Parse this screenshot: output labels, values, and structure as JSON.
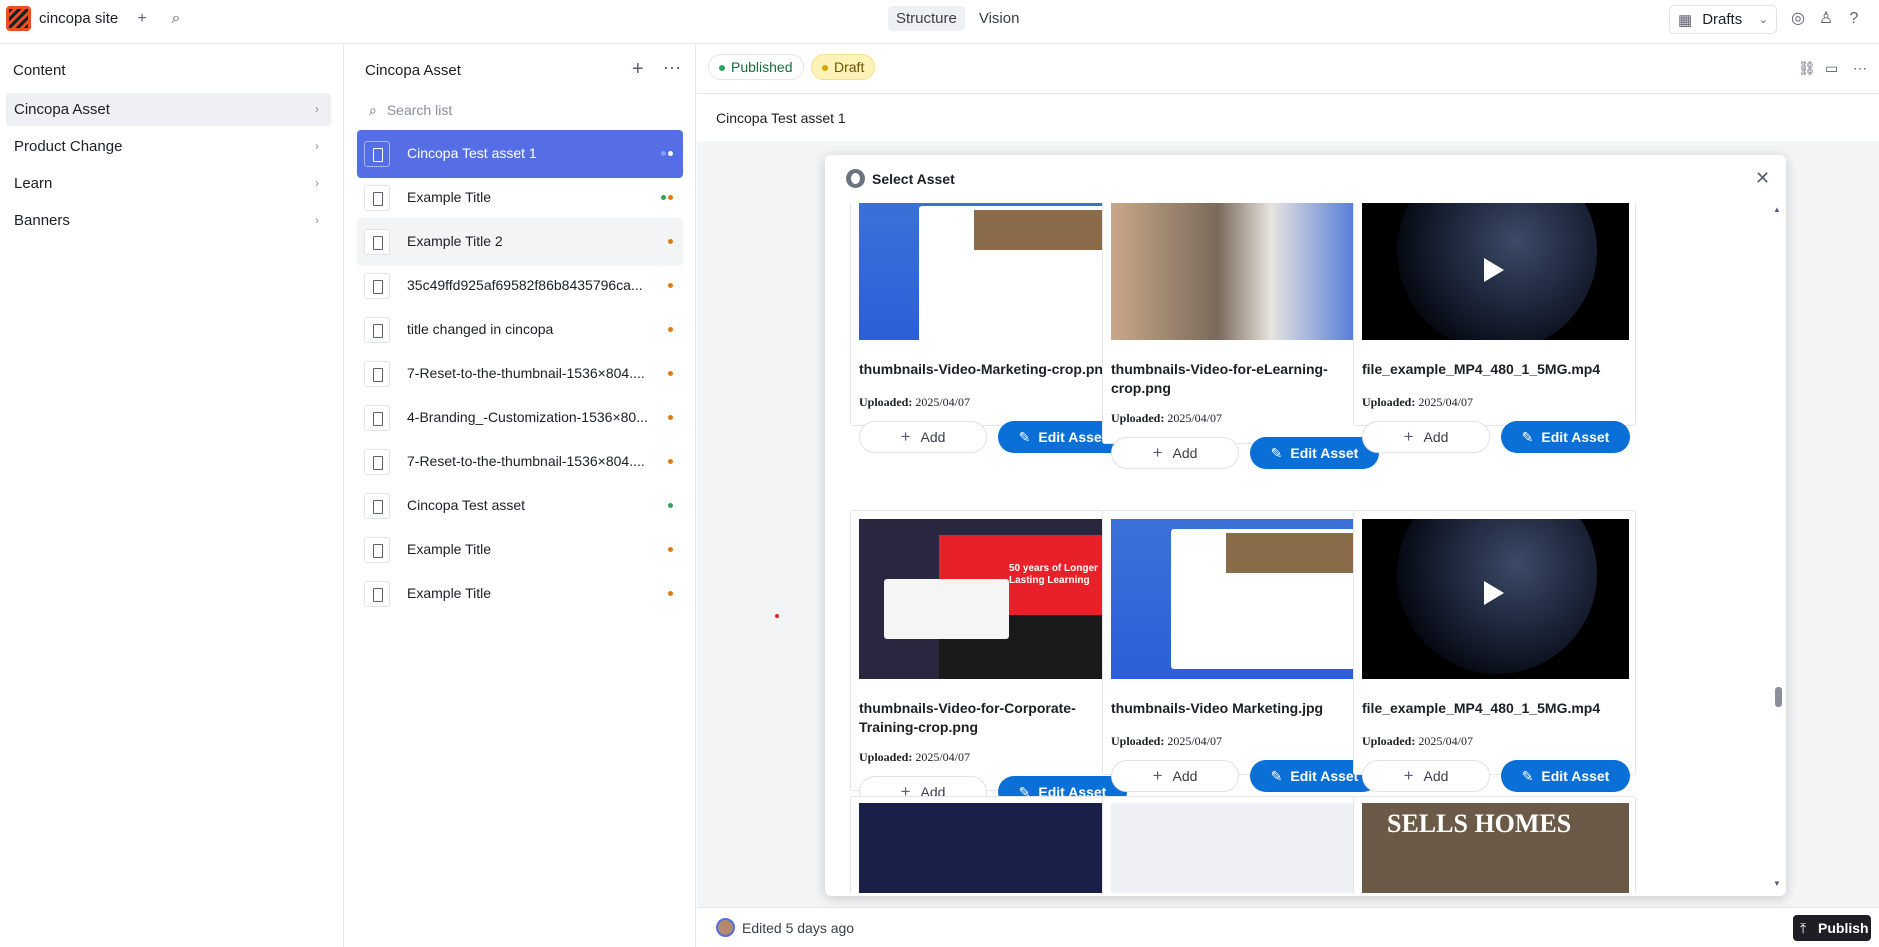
{
  "topbar": {
    "site_name": "cincopa site",
    "tabs": [
      "Structure",
      "Vision"
    ],
    "perspective": "Drafts"
  },
  "content_pane": {
    "title": "Content",
    "items": [
      {
        "label": "Cincopa Asset",
        "selected": true
      },
      {
        "label": "Product Change"
      },
      {
        "label": "Learn"
      },
      {
        "label": "Banners"
      }
    ]
  },
  "list_pane": {
    "title": "Cincopa Asset",
    "search_placeholder": "Search list",
    "documents": [
      {
        "title": "Cincopa Test asset 1",
        "status": [
          "#7ea0ff",
          "#ffffff"
        ]
      },
      {
        "title": "Example Title",
        "status": [
          "#2ea55a",
          "#e07b12"
        ]
      },
      {
        "title": "Example Title 2",
        "status": [
          "#e07b12"
        ]
      },
      {
        "title": "35c49ffd925af69582f86b8435796ca...",
        "status": [
          "#e07b12"
        ]
      },
      {
        "title": "title changed in cincopa",
        "status": [
          "#e07b12"
        ]
      },
      {
        "title": "7-Reset-to-the-thumbnail-1536×804....",
        "status": [
          "#e07b12"
        ]
      },
      {
        "title": "4-Branding_-Customization-1536×80...",
        "status": [
          "#e07b12"
        ]
      },
      {
        "title": "7-Reset-to-the-thumbnail-1536×804....",
        "status": [
          "#e07b12"
        ]
      },
      {
        "title": "Cincopa Test asset",
        "status": [
          "#2ea55a"
        ]
      },
      {
        "title": "Example Title",
        "status": [
          "#e07b12"
        ]
      },
      {
        "title": "Example Title",
        "status": [
          "#e07b12"
        ]
      }
    ]
  },
  "editor": {
    "published_label": "Published",
    "draft_label": "Draft",
    "document_title": "Cincopa Test asset 1",
    "edited": "Edited 5 days ago",
    "publish_label": "Publish"
  },
  "modal": {
    "title": "Select Asset",
    "uploaded_label": "Uploaded:",
    "add_label": "Add",
    "edit_label": "Edit Asset",
    "assets": [
      {
        "name": "thumbnails-Video-Marketing-crop.png",
        "uploaded": "2025/04/07",
        "kind": "marketing"
      },
      {
        "name": "thumbnails-Video-for-eLearning-crop.png",
        "uploaded": "2025/04/07",
        "kind": "elearning"
      },
      {
        "name": "file_example_MP4_480_1_5MG.mp4",
        "uploaded": "2025/04/07",
        "kind": "video"
      },
      {
        "name": "thumbnails-Video-for-Corporate-Training-crop.png",
        "uploaded": "2025/04/07",
        "kind": "corporate",
        "thumb_text": "50 years of Longer Lasting Learning"
      },
      {
        "name": "thumbnails-Video Marketing.jpg",
        "uploaded": "2025/04/07",
        "kind": "marketing"
      },
      {
        "name": "file_example_MP4_480_1_5MG.mp4",
        "uploaded": "2025/04/07",
        "kind": "video"
      }
    ],
    "partial_thumb_text": "SELLS HOMES"
  }
}
